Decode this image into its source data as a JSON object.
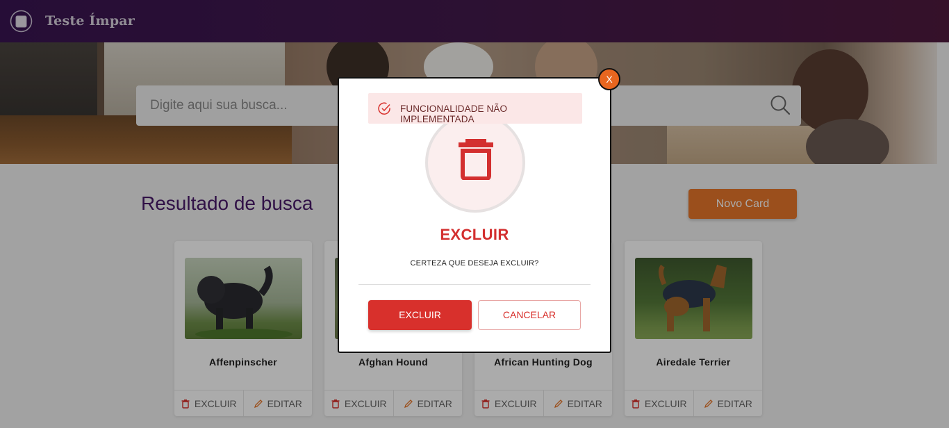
{
  "header": {
    "brand": "Teste Ímpar",
    "logo_icon": "logo-icon"
  },
  "search": {
    "placeholder": "Digite aqui sua busca...",
    "value": ""
  },
  "section": {
    "title": "Resultado de busca",
    "new_card_label": "Novo Card"
  },
  "cards": [
    {
      "name": "Affenpinscher",
      "delete_label": "EXCLUIR",
      "edit_label": "EDITAR"
    },
    {
      "name": "Afghan Hound",
      "delete_label": "EXCLUIR",
      "edit_label": "EDITAR"
    },
    {
      "name": "African Hunting Dog",
      "delete_label": "EXCLUIR",
      "edit_label": "EDITAR"
    },
    {
      "name": "Airedale Terrier",
      "delete_label": "EXCLUIR",
      "edit_label": "EDITAR"
    }
  ],
  "modal": {
    "close_label": "X",
    "toast": "FUNCIONALIDADE NÃO IMPLEMENTADA",
    "title": "EXCLUIR",
    "message": "CERTEZA QUE DESEJA EXCLUIR?",
    "confirm_label": "EXCLUIR",
    "cancel_label": "CANCELAR"
  },
  "colors": {
    "brand": "#3a1452",
    "accent": "#e8772a",
    "danger": "#d8302c"
  }
}
